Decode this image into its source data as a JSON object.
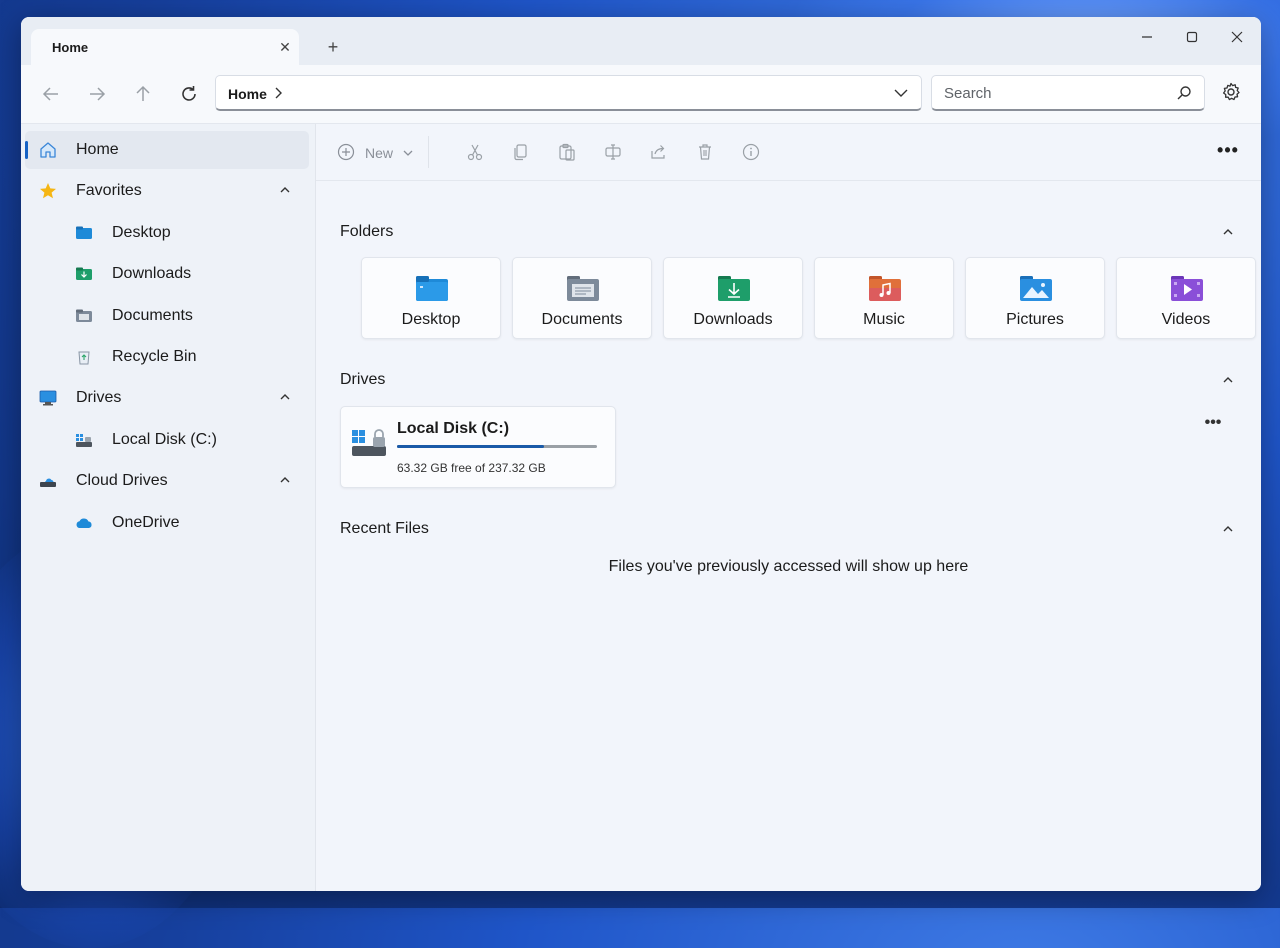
{
  "tab": {
    "label": "Home"
  },
  "window": {
    "minimize": "—",
    "maximize": "☐",
    "close": "✕",
    "new_tab": "+"
  },
  "nav": {
    "address": "Home",
    "search_placeholder": "Search"
  },
  "sidebar": {
    "items": [
      {
        "label": "Home",
        "icon": "home-icon",
        "active": true
      },
      {
        "label": "Favorites",
        "icon": "star-icon",
        "group": true
      },
      {
        "label": "Desktop",
        "icon": "desktop-folder-icon"
      },
      {
        "label": "Downloads",
        "icon": "downloads-folder-icon"
      },
      {
        "label": "Documents",
        "icon": "documents-folder-icon"
      },
      {
        "label": "Recycle Bin",
        "icon": "recycle-bin-icon"
      },
      {
        "label": "Drives",
        "icon": "monitor-icon",
        "group": true
      },
      {
        "label": "Local Disk (C:)",
        "icon": "drive-icon"
      },
      {
        "label": "Cloud Drives",
        "icon": "cloud-drives-icon",
        "group": true
      },
      {
        "label": "OneDrive",
        "icon": "onedrive-icon"
      }
    ]
  },
  "commands": {
    "new_label": "New",
    "more": "•••"
  },
  "sections": {
    "folders": "Folders",
    "drives": "Drives",
    "recent": "Recent Files"
  },
  "folders": [
    {
      "label": "Desktop",
      "icon": "desktop-folder-icon",
      "color": "#1e8ad8"
    },
    {
      "label": "Documents",
      "icon": "documents-folder-icon",
      "color": "#7d8a9a"
    },
    {
      "label": "Downloads",
      "icon": "downloads-folder-icon",
      "color": "#1e9e6a"
    },
    {
      "label": "Music",
      "icon": "music-folder-icon",
      "color": "#e0703a"
    },
    {
      "label": "Pictures",
      "icon": "pictures-folder-icon",
      "color": "#2a8fe0"
    },
    {
      "label": "Videos",
      "icon": "videos-folder-icon",
      "color": "#8a4fd8"
    }
  ],
  "drive": {
    "name": "Local Disk (C:)",
    "free_text": "63.32 GB free of 237.32 GB",
    "used_fraction": 0.733,
    "more": "•••"
  },
  "recent": {
    "empty_message": "Files you've previously accessed will show up here"
  },
  "colors": {
    "accent": "#1662c4",
    "drive_bar": "#1a5aa8"
  }
}
